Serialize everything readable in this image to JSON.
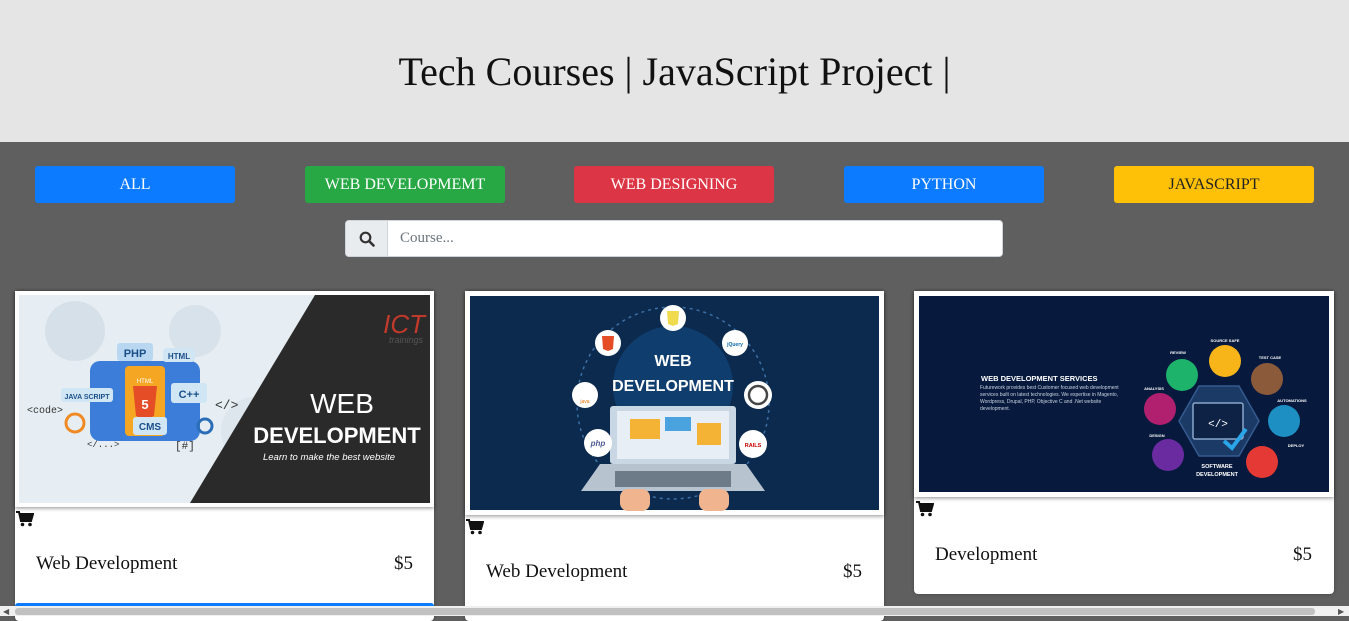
{
  "header": {
    "title": "Tech Courses | JavaScript Project |"
  },
  "filters": [
    {
      "label": "ALL",
      "color": "#0d7bff"
    },
    {
      "label": "WEB DEVELOPMEMT",
      "color": "#28a745"
    },
    {
      "label": "WEB DESIGNING",
      "color": "#dc3545"
    },
    {
      "label": "PYTHON",
      "color": "#0d7bff"
    },
    {
      "label": "JAVASCRIPT",
      "color": "#ffc107"
    }
  ],
  "search": {
    "placeholder": "Course...",
    "icon": "search-icon"
  },
  "cards": [
    {
      "title": "Web Development",
      "price": "$5",
      "image": {
        "heading1": "WEB",
        "heading2": "DEVELOPMENT",
        "tagline": "Learn to make the best website",
        "brand1": "ICT",
        "brand2": "trainings",
        "badges": [
          "PHP",
          "HTML",
          "JAVA SCRIPT",
          "C++",
          "CMS",
          "<code>",
          "</>",
          "[#]",
          "</...>"
        ]
      }
    },
    {
      "title": "Web Development",
      "price": "$5",
      "image": {
        "heading1": "WEB",
        "heading2": "DEVELOPMENT",
        "logos": [
          "jQuery",
          "php",
          "java",
          "RAILS"
        ]
      }
    },
    {
      "title": "Development",
      "price": "$5",
      "image": {
        "heading": "WEB DEVELOPMENT SERVICES",
        "body": "Futurework provides best Customer focused web development services built on latest technologies. We expertise in Magento, Wordpress, Drupal, PHP, Objective C and .Net website development.",
        "center1": "SOFTWARE",
        "center2": "DEVELOPMENT",
        "stages": [
          "SOURCE SAFE",
          "REVIEW",
          "TEST CASE",
          "ANALYSIS",
          "AUTOMATIONS",
          "DESIGN",
          "DEPLOY"
        ]
      }
    }
  ]
}
